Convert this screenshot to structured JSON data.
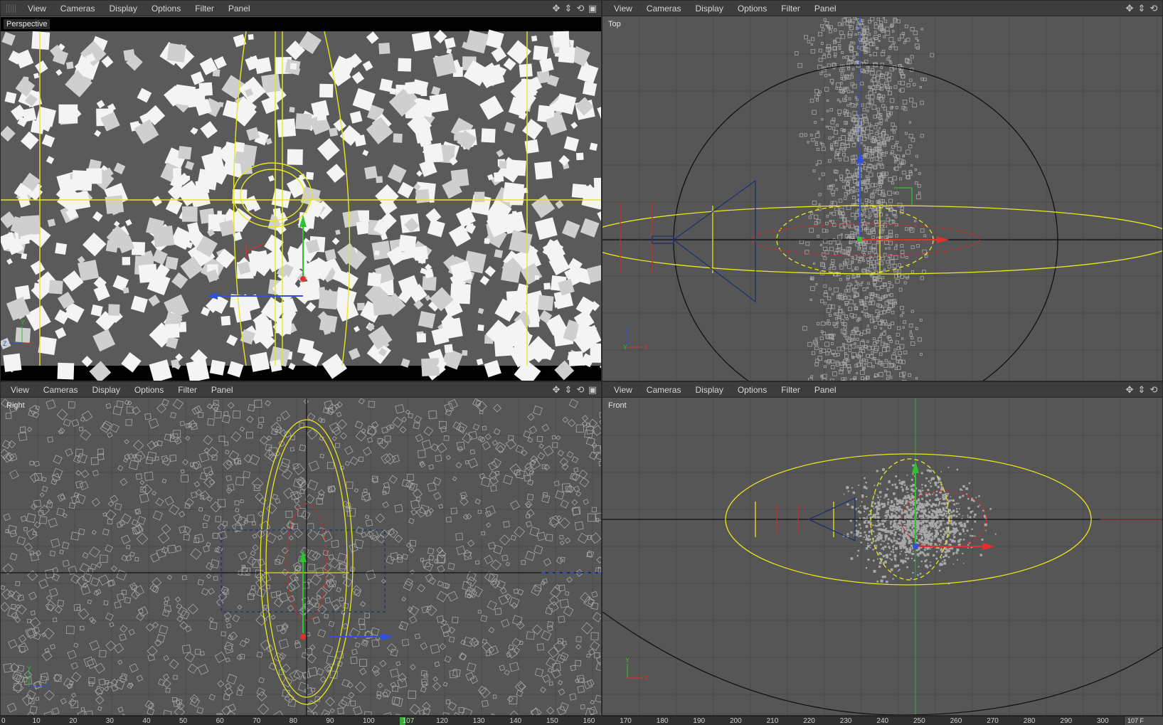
{
  "menu": {
    "items": [
      "View",
      "Cameras",
      "Display",
      "Options",
      "Filter",
      "Panel"
    ]
  },
  "viewports": {
    "perspective": {
      "label": "Perspective"
    },
    "top": {
      "label": "Top"
    },
    "right": {
      "label": "Right"
    },
    "front": {
      "label": "Front"
    }
  },
  "axes": {
    "x": "X",
    "y": "Y",
    "z": "Z"
  },
  "toolbar_icons": [
    "move-view-icon",
    "zoom-view-icon",
    "rotate-view-icon",
    "maximize-panel-icon"
  ],
  "colors": {
    "viewport_bg": "#565656",
    "grid": "#4a4a4a",
    "yellow_guides": "#e8e820",
    "x_axis": "#e03030",
    "y_axis": "#30c030",
    "z_axis": "#3050e0",
    "particles": "#a8a8a8",
    "cubes": "#f4f4f4"
  },
  "timeline": {
    "ticks": [
      "0",
      "10",
      "20",
      "30",
      "40",
      "50",
      "60",
      "70",
      "80",
      "90",
      "100",
      "107",
      "120",
      "130",
      "140",
      "150",
      "160",
      "170",
      "180",
      "190",
      "200",
      "210",
      "220",
      "230",
      "240",
      "250",
      "260",
      "270",
      "280",
      "290",
      "300"
    ],
    "current_frame": "107",
    "corner": "107 F"
  }
}
